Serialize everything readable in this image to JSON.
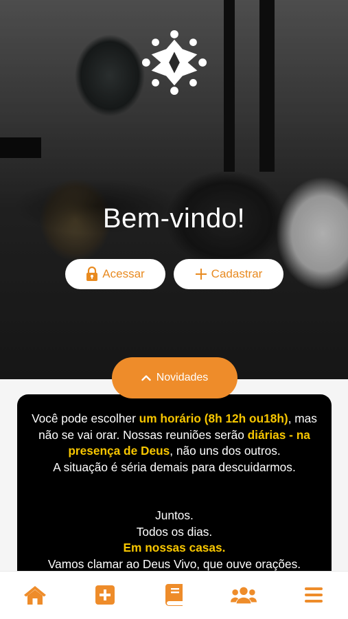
{
  "hero": {
    "welcome": "Bem-vindo!",
    "login_label": "Acessar",
    "register_label": "Cadastrar"
  },
  "news": {
    "label": "Novidades",
    "p1_a": "Você pode escolher ",
    "p1_b": "um horário (8h 12h ou18h)",
    "p1_c": ", mas não se vai orar. Nossas reuniões  serão ",
    "p1_d": "diárias - na presença de Deus",
    "p1_e": ", não uns dos outros.",
    "p2": "A situação é séria demais para descuidarmos.",
    "l1": "Juntos.",
    "l2": "Todos os dias.",
    "l3": "Em nossas casas.",
    "l4": "Vamos clamar ao Deus Vivo, que ouve orações."
  },
  "colors": {
    "accent": "#ee8c2a",
    "highlight": "#f7c600",
    "card_bg": "#000000"
  },
  "tabbar": {
    "icons": [
      "home-icon",
      "plus-square-icon",
      "book-icon",
      "users-icon",
      "menu-icon"
    ]
  }
}
